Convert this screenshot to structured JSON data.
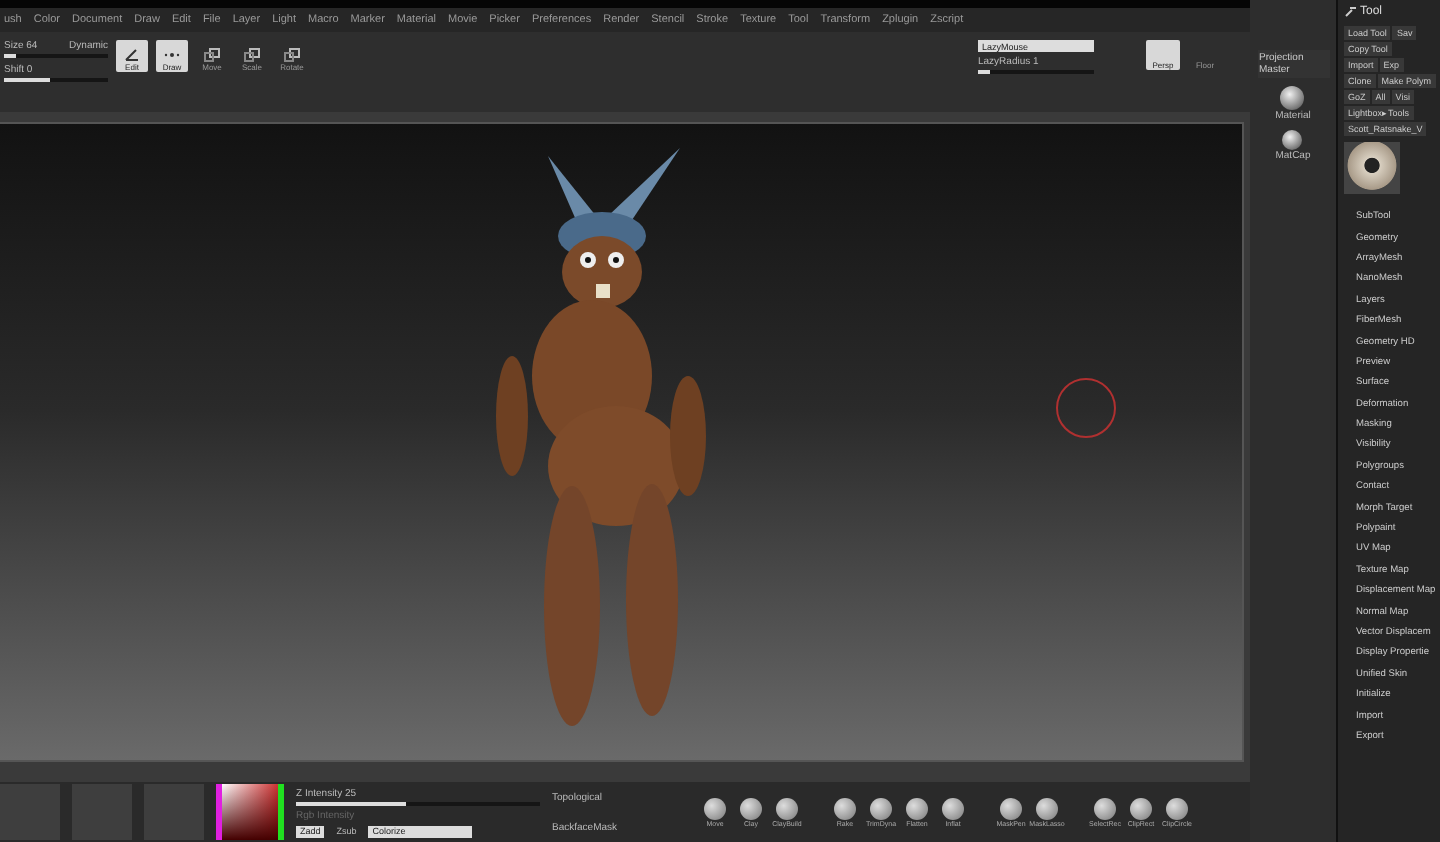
{
  "menu": [
    "ush",
    "Color",
    "Document",
    "Draw",
    "Edit",
    "File",
    "Layer",
    "Light",
    "Macro",
    "Marker",
    "Material",
    "Movie",
    "Picker",
    "Preferences",
    "Render",
    "Stencil",
    "Stroke",
    "Texture",
    "Tool",
    "Transform",
    "Zplugin",
    "Zscript"
  ],
  "toolbar": {
    "sliders": [
      {
        "label": "Size 64",
        "level": 0.12
      },
      {
        "label": "Shift 0",
        "level": 0.45
      }
    ],
    "dynamic": "Dynamic",
    "modes": [
      {
        "label": "Edit",
        "selected": true,
        "kind": "edit"
      },
      {
        "label": "Draw",
        "selected": true,
        "kind": "draw"
      },
      {
        "label": "Move",
        "selected": false,
        "kind": "move"
      },
      {
        "label": "Scale",
        "selected": false,
        "kind": "scale"
      },
      {
        "label": "Rotate",
        "selected": false,
        "kind": "rotate"
      }
    ],
    "lazy_mouse": {
      "label": "LazyMouse",
      "on": true
    },
    "lazy_radius": {
      "label": "LazyRadius 1",
      "level": 0.1
    },
    "view_buttons": [
      {
        "label": "Persp",
        "selected": true
      },
      {
        "label": "Floor",
        "selected": false
      }
    ]
  },
  "side_column": {
    "projection_master": "Projection Master",
    "materials": [
      "Material",
      "MatCap"
    ]
  },
  "tool_panel": {
    "title": "Tool",
    "button_rows": [
      [
        "Load Tool",
        "Sav"
      ],
      [
        "Copy Tool"
      ],
      [
        "Import",
        "Exp"
      ],
      [
        "Clone",
        "Make Polym"
      ],
      [
        "GoZ",
        "All",
        "Visi"
      ],
      [
        "Lightbox▸Tools"
      ],
      [
        "Scott_Ratsnake_V"
      ]
    ],
    "subpalettes": [
      "SubTool",
      "Geometry",
      "ArrayMesh",
      "NanoMesh",
      "Layers",
      "FiberMesh",
      "Geometry HD",
      "Preview",
      "Surface",
      "Deformation",
      "Masking",
      "Visibility",
      "Polygroups",
      "Contact",
      "Morph Target",
      "Polypaint",
      "UV Map",
      "Texture Map",
      "Displacement Map",
      "Normal Map",
      "Vector Displacem",
      "Display Propertie",
      "Unified Skin",
      "Initialize",
      "Import",
      "Export"
    ]
  },
  "bottom_shelf": {
    "intensity": {
      "label": "Z Intensity 25",
      "level": 0.45
    },
    "rgb_intensity": "Rgb Intensity",
    "modes": [
      {
        "label": "Zadd",
        "selected": true
      },
      {
        "label": "Zsub",
        "selected": false
      }
    ],
    "colorize": "Colorize",
    "topological": "Topological",
    "backface": "BackfaceMask",
    "brushes": [
      [
        "Move",
        "Clay",
        "ClayBuild"
      ],
      [
        "Rake",
        "TrimDyna",
        "Flatten",
        "Inflat"
      ],
      [
        "MaskPen",
        "MaskLasso"
      ],
      [
        "SelectRec",
        "ClipRect",
        "ClipCircle"
      ]
    ]
  }
}
